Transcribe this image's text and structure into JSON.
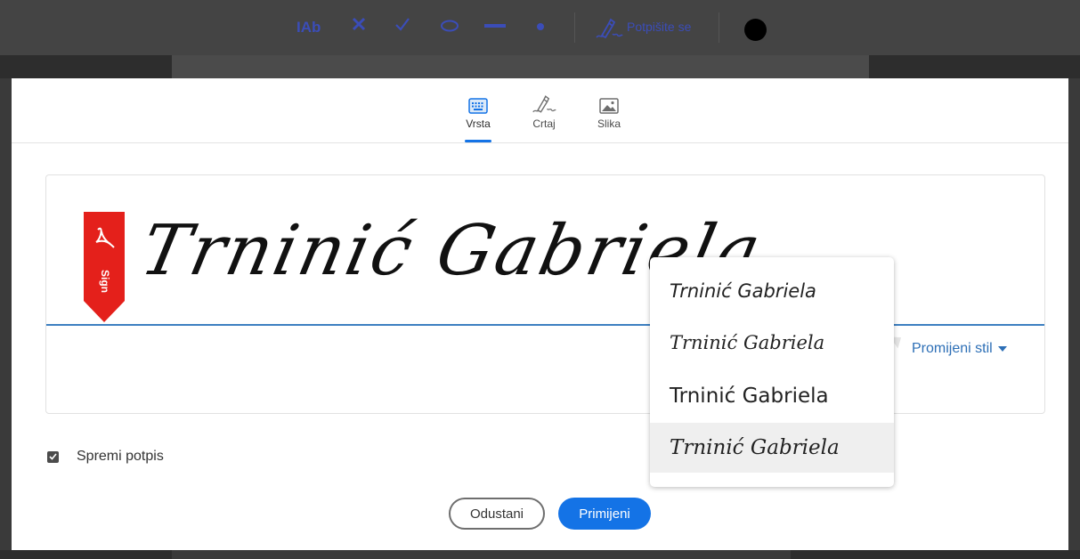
{
  "toolbar": {
    "items": [
      {
        "name": "add-text-tool",
        "label": "Ab"
      },
      {
        "name": "cross-tool"
      },
      {
        "name": "check-tool"
      },
      {
        "name": "ellipse-tool"
      },
      {
        "name": "line-tool"
      },
      {
        "name": "dot-tool"
      }
    ],
    "sign_label": "Potpišite se",
    "color_swatch": "#000000",
    "accent": "#3b4db8"
  },
  "dialog": {
    "tabs": [
      {
        "id": "type",
        "label": "Vrsta",
        "icon": "keyboard-icon",
        "active": true
      },
      {
        "id": "draw",
        "label": "Crtaj",
        "icon": "pen-signature-icon",
        "active": false
      },
      {
        "id": "image",
        "label": "Slika",
        "icon": "image-icon",
        "active": false
      }
    ],
    "signature": {
      "text": "Trninić Gabriela",
      "sign_tag_label": "Sign",
      "line_color": "#3d7fc1"
    },
    "change_style_label": "Promijeni stil",
    "style_options": [
      {
        "text": "Trninić Gabriela",
        "selected": false
      },
      {
        "text": "Trninić Gabriela",
        "selected": false
      },
      {
        "text": "Trninić Gabriela",
        "selected": false
      },
      {
        "text": "Trninić Gabriela",
        "selected": true
      }
    ],
    "save_signature": {
      "label": "Spremi potpis",
      "checked": true
    },
    "buttons": {
      "cancel": "Odustani",
      "apply": "Primijeni"
    },
    "primary_color": "#1473e6"
  }
}
